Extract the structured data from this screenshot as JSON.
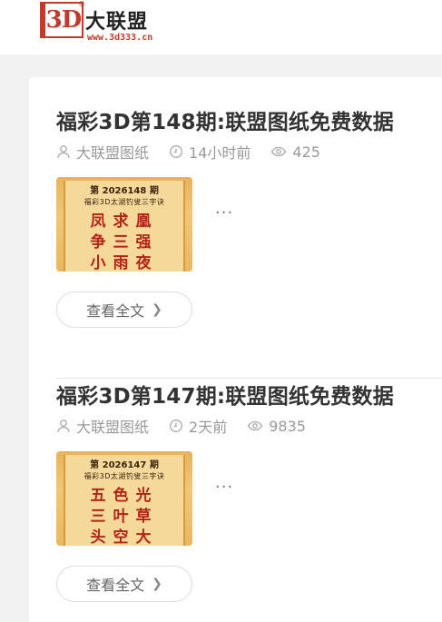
{
  "header": {
    "logo_mark": "3D",
    "logo_reg": "®",
    "logo_title": "大联盟",
    "logo_url": "www.3d333.cn"
  },
  "posts": [
    {
      "title": "福彩3D第148期:联盟图纸免费数据",
      "author": "大联盟图纸",
      "time": "14小时前",
      "views": "425",
      "thumb_issue": "第 2026148 期",
      "thumb_sub": "福彩3D太湖钓叟三字诀",
      "thumb_poem": [
        "凤求凰",
        "争三强",
        "小雨夜"
      ],
      "excerpt": "...",
      "read_more": "查看全文"
    },
    {
      "title": "福彩3D第147期:联盟图纸免费数据",
      "author": "大联盟图纸",
      "time": "2天前",
      "views": "9835",
      "thumb_issue": "第 2026147 期",
      "thumb_sub": "福彩3D太湖钓叟三字诀",
      "thumb_poem": [
        "五色光",
        "三叶草",
        "头空大"
      ],
      "excerpt": "...",
      "read_more": "查看全文"
    }
  ],
  "icons": {
    "author": "user-icon",
    "time": "clock-icon",
    "views": "eye-icon",
    "more": "chevron-right-icon"
  },
  "colors": {
    "brand_red": "#c23a2b",
    "meta_gray": "#999999",
    "title": "#333333"
  }
}
